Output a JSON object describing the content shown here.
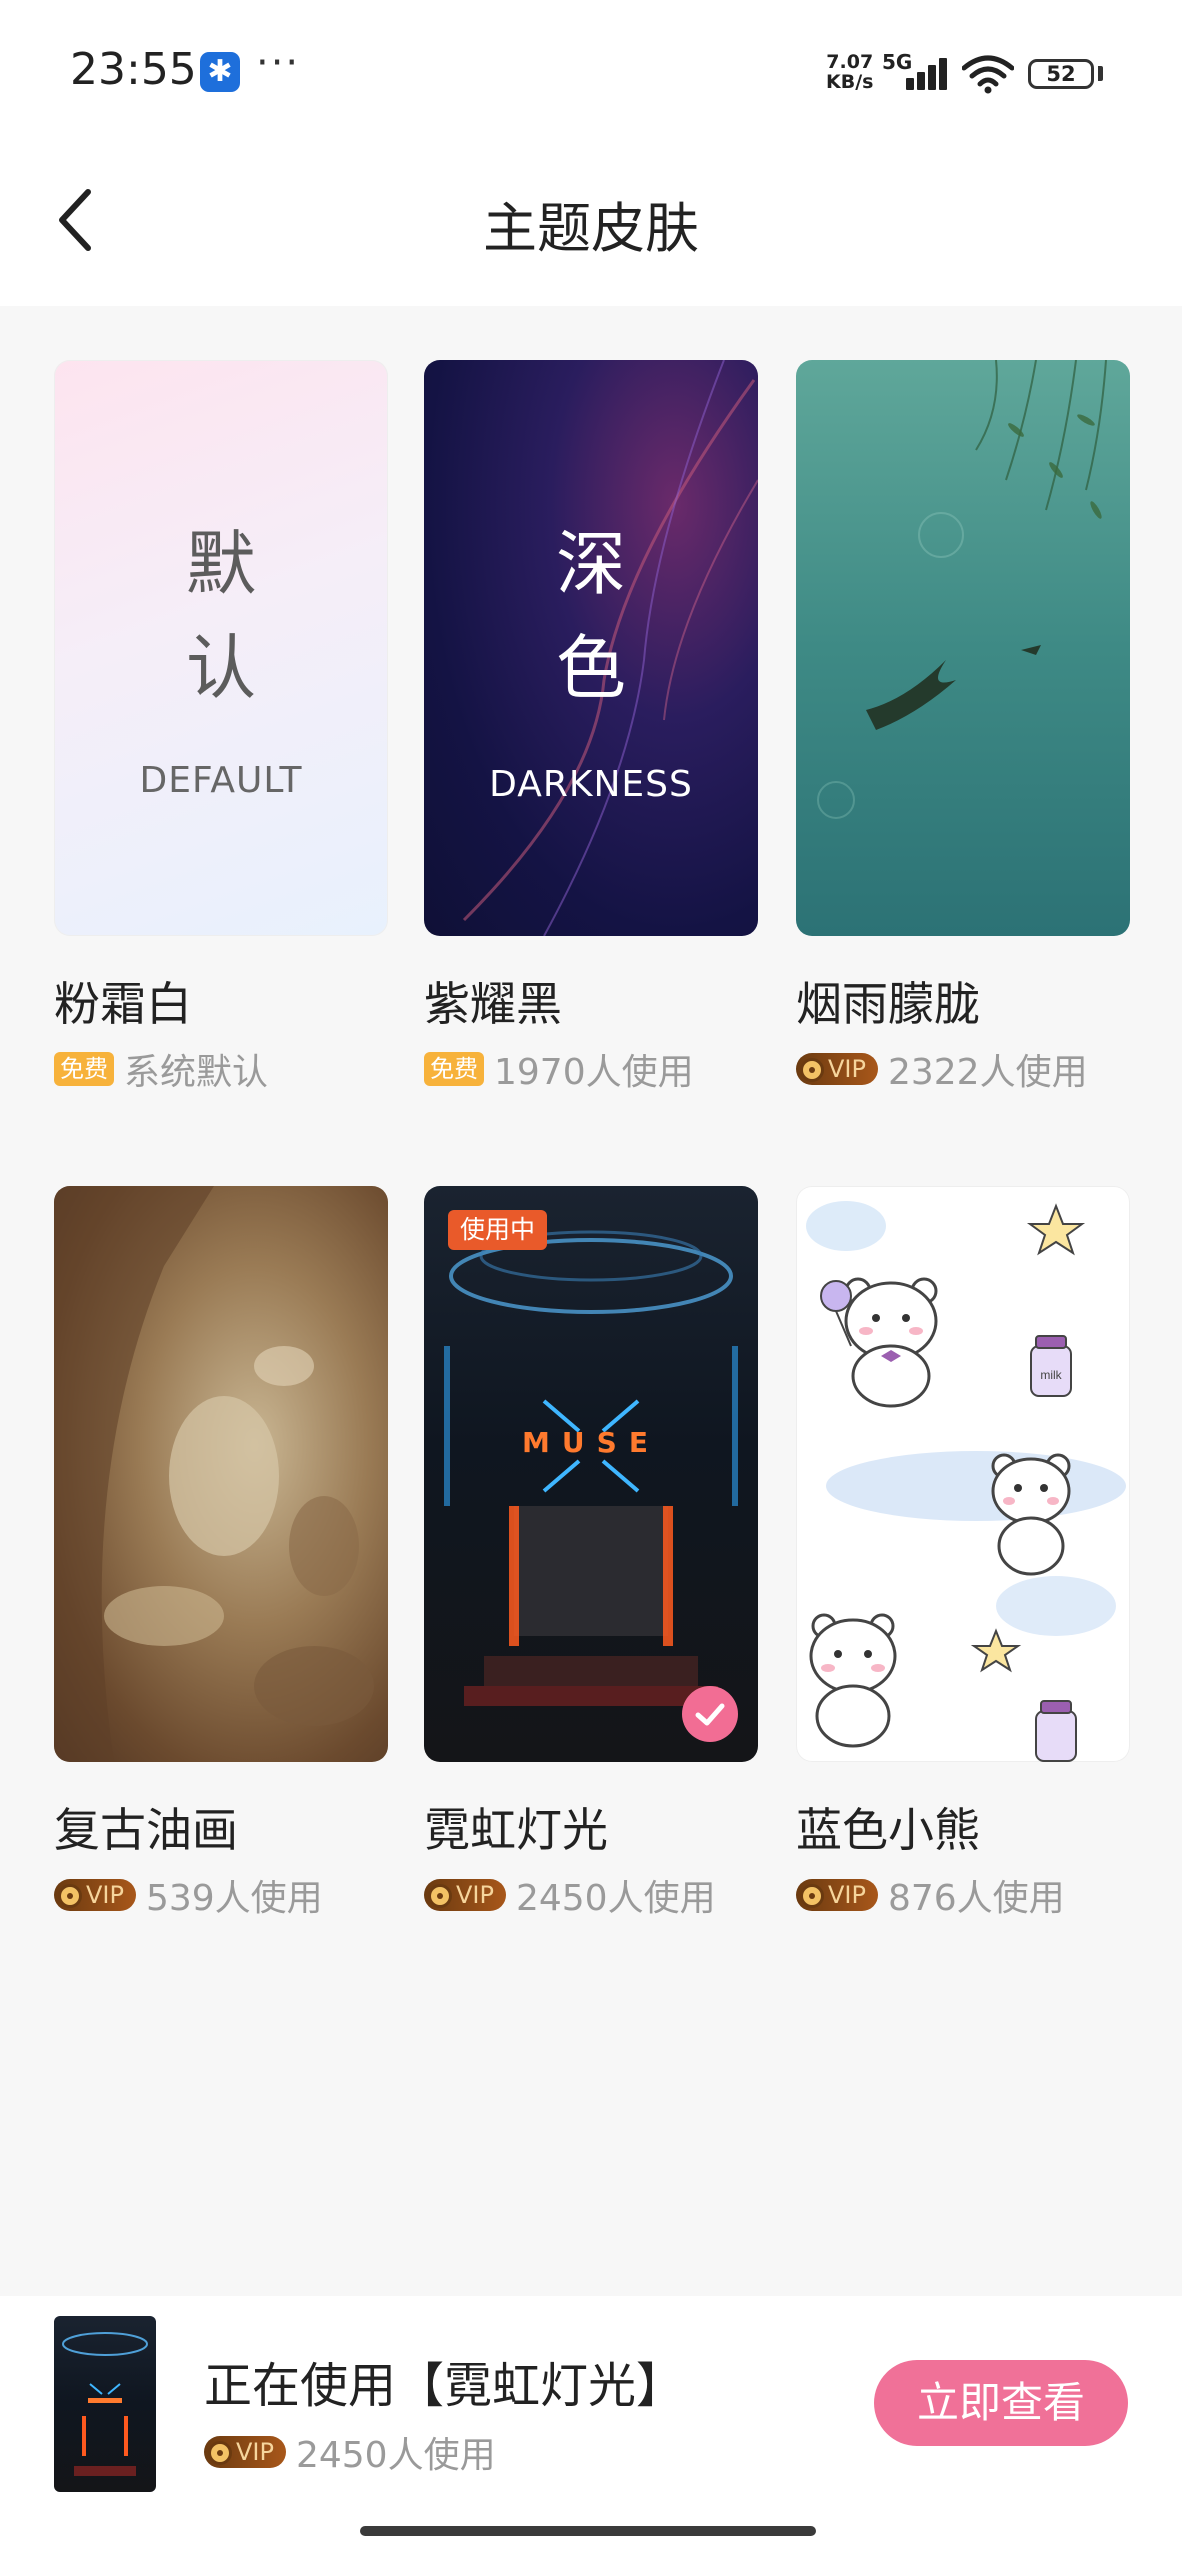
{
  "status_bar": {
    "time": "23:55",
    "net_speed_value": "7.07",
    "net_speed_unit": "KB/s",
    "network_type": "5G",
    "battery": "52",
    "more_dots": "···",
    "app_notif_icon": "star-app-icon"
  },
  "header": {
    "title": "主题皮肤",
    "back_icon": "chevron-left-icon"
  },
  "themes": [
    {
      "name": "粉霜白",
      "thumb_cn_1": "默",
      "thumb_cn_2": "认",
      "thumb_en": "DEFAULT",
      "badge": "免费",
      "usage": "系统默认"
    },
    {
      "name": "紫耀黑",
      "thumb_cn_1": "深",
      "thumb_cn_2": "色",
      "thumb_en": "DARKNESS",
      "badge": "免费",
      "usage": "1970人使用"
    },
    {
      "name": "烟雨朦胧",
      "badge": "VIP",
      "usage": "2322人使用"
    },
    {
      "name": "复古油画",
      "badge": "VIP",
      "usage": "539人使用"
    },
    {
      "name": "霓虹灯光",
      "badge": "VIP",
      "usage": "2450人使用",
      "using_tag": "使用中",
      "sign": "MUSE",
      "selected": true
    },
    {
      "name": "蓝色小熊",
      "badge": "VIP",
      "usage": "876人使用",
      "jar_label": "milk"
    }
  ],
  "bottom_bar": {
    "current_label": "正在使用【霓虹灯光】",
    "badge": "VIP",
    "usage": "2450人使用",
    "view_button": "立即查看"
  },
  "colors": {
    "accent_pink": "#f07198",
    "free_badge": "#f7b23b",
    "using_tag": "#e95a2a"
  }
}
